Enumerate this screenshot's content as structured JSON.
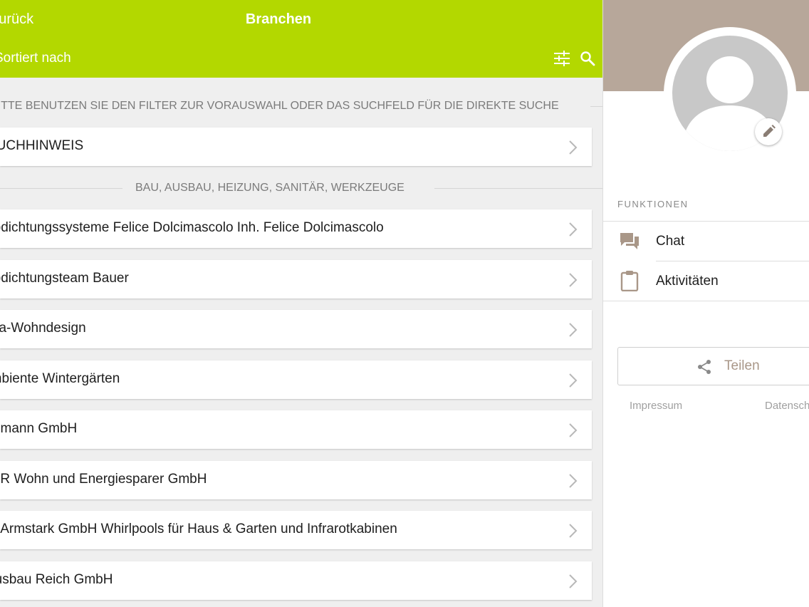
{
  "header": {
    "back_label": "Zurück",
    "title": "Branchen",
    "sort_label": "Sortiert nach",
    "filter_icon": "sliders-icon",
    "search_icon": "search-icon"
  },
  "list": {
    "hint_section_label": "BITTE BENUTZEN SIE DEN FILTER ZUR VORAUSWAHL ODER DAS SUCHFELD FÜR DIE DIREKTE SUCHE",
    "hint_item": "SUCHHINWEIS",
    "category_label": "BAU, AUSBAU, HEIZUNG, SANITÄR, WERKZEUGE",
    "items": [
      "Abdichtungssysteme Felice Dolcimascolo Inh. Felice Dolcimascolo",
      "Abdichtungsteam Bauer",
      "Alba-Wohndesign",
      "Ambiente Wintergärten",
      "Ammann GmbH",
      "ANR Wohn und Energiesparer GmbH",
      "H. Armstark GmbH Whirlpools für Haus & Garten und Infrarotkabinen",
      "Ausbau Reich GmbH"
    ]
  },
  "profile": {
    "functions_label": "FUNKTIONEN",
    "menu": [
      {
        "label": "Chat",
        "icon": "chat-bubbles-icon"
      },
      {
        "label": "Aktivitäten",
        "icon": "clipboard-icon"
      }
    ],
    "share_label": "Teilen",
    "impressum_label": "Impressum",
    "datenschutz_label": "Datenschutz"
  },
  "colors": {
    "header_green": "#b3d800",
    "cover_brown": "#b7a79a",
    "accent_text": "#a99788"
  }
}
